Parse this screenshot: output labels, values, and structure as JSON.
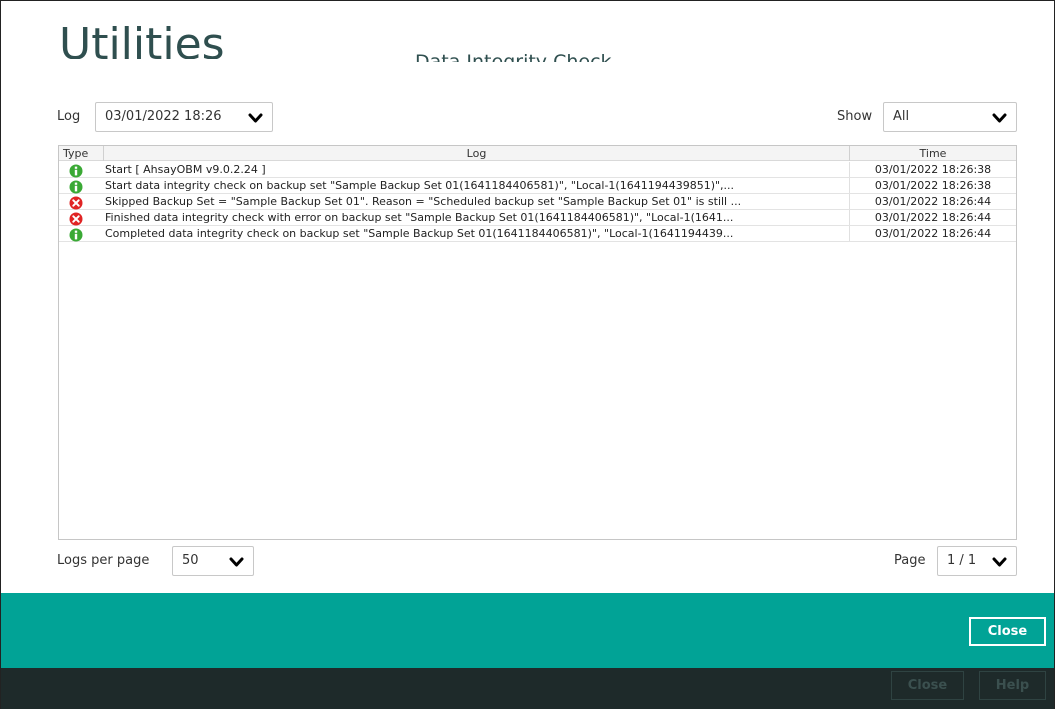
{
  "background": {
    "title": "Utilities",
    "subtitle": "Data Integrity Check",
    "buttons": {
      "close": "Close",
      "help": "Help"
    }
  },
  "dialog": {
    "log_label": "Log",
    "log_selected": "03/01/2022 18:26",
    "show_label": "Show",
    "show_selected": "All",
    "table": {
      "headers": {
        "type": "Type",
        "log": "Log",
        "time": "Time"
      },
      "rows": [
        {
          "type": "info",
          "log": "Start [ AhsayOBM v9.0.2.24 ]",
          "time": "03/01/2022 18:26:38"
        },
        {
          "type": "info",
          "log": "Start data integrity check on backup set \"Sample Backup Set 01(1641184406581)\", \"Local-1(1641194439851)\",...",
          "time": "03/01/2022 18:26:38"
        },
        {
          "type": "error",
          "log": "Skipped Backup Set = \"Sample Backup Set 01\". Reason = \"Scheduled backup set \"Sample Backup Set 01\" is still ...",
          "time": "03/01/2022 18:26:44"
        },
        {
          "type": "error",
          "log": "Finished data integrity check with error on backup set \"Sample Backup Set 01(1641184406581)\", \"Local-1(1641...",
          "time": "03/01/2022 18:26:44"
        },
        {
          "type": "info",
          "log": "Completed data integrity check on backup set \"Sample Backup Set 01(1641184406581)\", \"Local-1(1641194439...",
          "time": "03/01/2022 18:26:44"
        }
      ]
    },
    "logs_per_page_label": "Logs per page",
    "logs_per_page_value": "50",
    "page_label": "Page",
    "page_value": "1 / 1",
    "close_label": "Close"
  },
  "colors": {
    "teal": "#01a396",
    "dark": "#1e2a2a",
    "info": "#3aa935",
    "error": "#e02424"
  },
  "icons": {
    "info": "info-circle-icon",
    "error": "error-x-circle-icon",
    "dropdown": "chevron-down-icon"
  }
}
